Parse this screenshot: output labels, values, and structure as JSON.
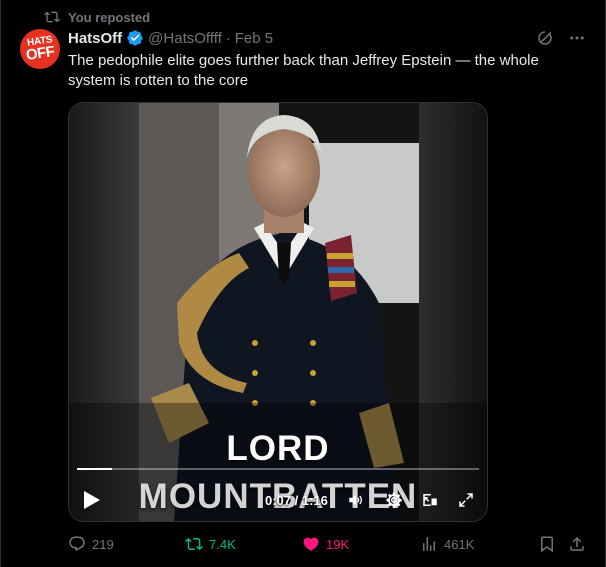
{
  "repost_banner": {
    "text": "You reposted",
    "icon": "repost-icon"
  },
  "author": {
    "avatar_line1": "HATS",
    "avatar_line2": "OFF",
    "display_name": "HatsOff",
    "handle": "@HatsOffff",
    "separator": "·",
    "date": "Feb 5",
    "verified": true
  },
  "tweet": {
    "text": "The pedophile elite goes further back than Jeffrey Epstein — the whole system is rotten to the core"
  },
  "video": {
    "caption_line1": "LORD",
    "caption_line2": "MOUNTBATTEN",
    "time_display": "0:07 / 1:16",
    "progress_fraction": 0.087,
    "controls": [
      "play-icon",
      "volume-icon",
      "settings-icon",
      "picture-in-picture-icon",
      "fullscreen-icon"
    ]
  },
  "actions": {
    "replies": "219",
    "reposts": "7.4K",
    "likes": "19K",
    "views": "461K"
  },
  "colors": {
    "background": "#000000",
    "text": "#e7e9ea",
    "muted": "#71767b",
    "repost_green": "#00ba7c",
    "like_pink": "#f91880",
    "verified_blue": "#1d9bf0",
    "avatar_red": "#e5311f"
  }
}
